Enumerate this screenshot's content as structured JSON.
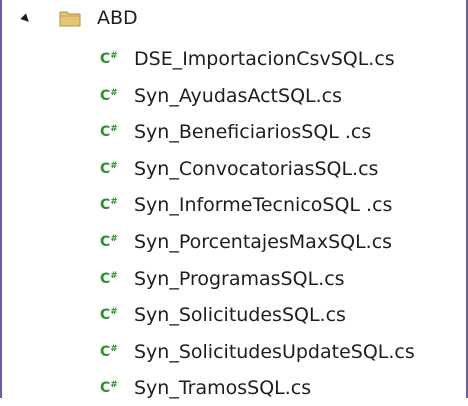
{
  "tree": {
    "folder": {
      "name": "ABD",
      "expanded": true,
      "icon": "folder-icon",
      "color": "#d9b35b"
    },
    "file_icon": {
      "glyph": "C",
      "suffix": "#",
      "color": "#2f8f2f"
    },
    "files": [
      "DSE_ImportacionCsvSQL.cs",
      "Syn_AyudasActSQL.cs",
      "Syn_BeneficiariosSQL .cs",
      "Syn_ConvocatoriasSQL.cs",
      "Syn_InformeTecnicoSQL .cs",
      "Syn_PorcentajesMaxSQL.cs",
      "Syn_ProgramasSQL.cs",
      "Syn_SolicitudesSQL.cs",
      "Syn_SolicitudesUpdateSQL.cs",
      "Syn_TramosSQL.cs"
    ]
  }
}
